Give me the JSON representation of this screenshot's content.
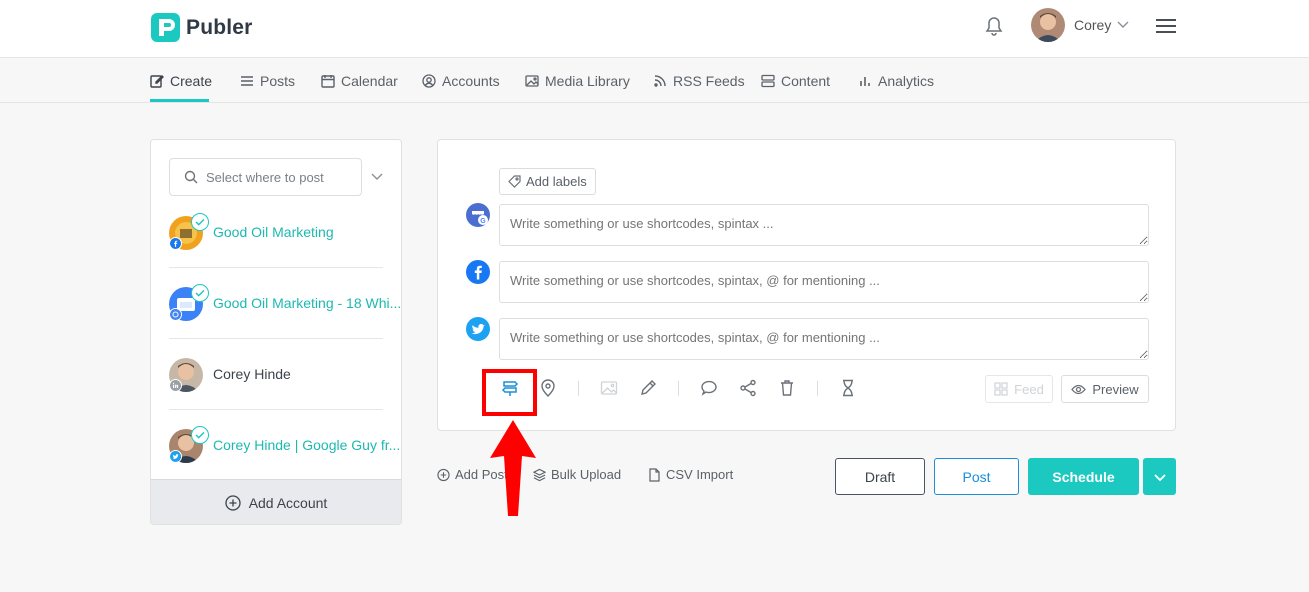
{
  "app": {
    "name": "Publer"
  },
  "colors": {
    "accent": "#1cc9c0",
    "post_blue": "#1a8fd8",
    "annotation_red": "#ff0000"
  },
  "header": {
    "user_name": "Corey",
    "icons": [
      "bell-icon",
      "chevron-down-icon",
      "hamburger-menu-icon"
    ]
  },
  "nav": {
    "items": [
      {
        "label": "Create",
        "icon": "edit-icon",
        "active": true
      },
      {
        "label": "Posts",
        "icon": "list-icon"
      },
      {
        "label": "Calendar",
        "icon": "calendar-icon"
      },
      {
        "label": "Accounts",
        "icon": "user-circle-icon"
      },
      {
        "label": "Media Library",
        "icon": "image-icon"
      },
      {
        "label": "RSS Feeds",
        "icon": "rss-icon"
      },
      {
        "label": "Content",
        "icon": "content-icon"
      },
      {
        "label": "Analytics",
        "icon": "bar-chart-icon"
      }
    ]
  },
  "sidebar": {
    "search_placeholder": "Select where to post",
    "accounts": [
      {
        "name": "Good Oil Marketing",
        "network": "facebook",
        "selected": true
      },
      {
        "name": "Good Oil Marketing - 18 Whi...",
        "network": "google-my-business",
        "selected": true
      },
      {
        "name": "Corey Hinde",
        "network": "linkedin",
        "selected": false
      },
      {
        "name": "Corey Hinde | Google Guy fr...",
        "network": "twitter",
        "selected": true
      }
    ],
    "add_account_label": "Add Account"
  },
  "composer": {
    "add_labels": "Add labels",
    "editors": [
      {
        "network": "google-my-business",
        "placeholder": "Write something or use shortcodes, spintax ..."
      },
      {
        "network": "facebook",
        "placeholder": "Write something or use shortcodes, spintax, @ for mentioning ..."
      },
      {
        "network": "twitter",
        "placeholder": "Write something or use shortcodes, spintax, @ for mentioning ..."
      }
    ],
    "toolbar_icons": [
      "signpost-icon",
      "location-pin-icon",
      "image-icon",
      "pencil-icon",
      "comment-icon",
      "share-icon",
      "trash-icon",
      "hourglass-icon"
    ],
    "feed_label": "Feed",
    "preview_label": "Preview"
  },
  "bottom": {
    "add_post": "Add Post",
    "bulk_upload": "Bulk Upload",
    "csv_import": "CSV Import",
    "draft": "Draft",
    "post": "Post",
    "schedule": "Schedule"
  }
}
